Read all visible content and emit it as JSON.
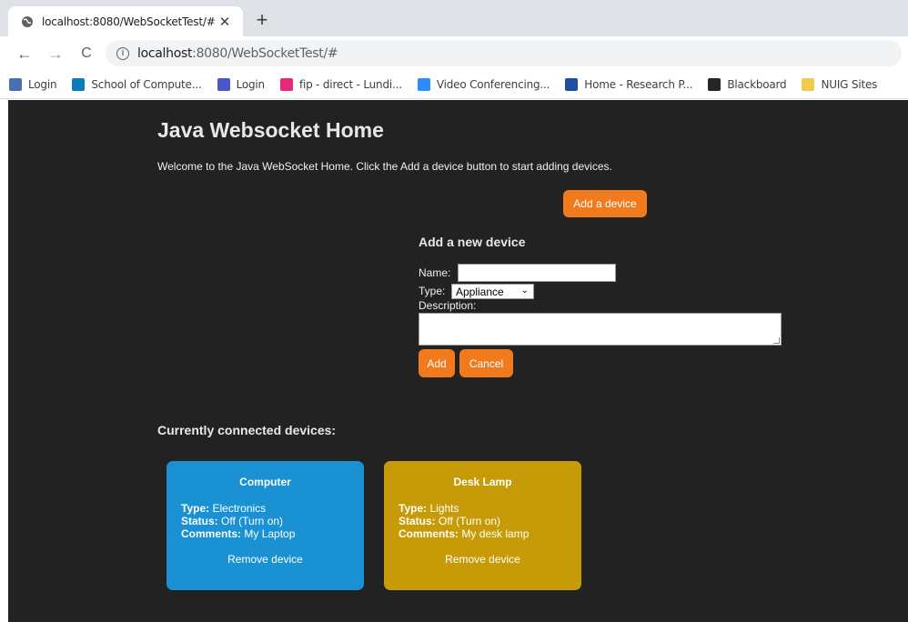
{
  "browser": {
    "tab_title": "localhost:8080/WebSocketTest/#",
    "tab_close": "✕",
    "new_tab": "+",
    "back": "←",
    "forward": "→",
    "reload": "C",
    "url_host": "localhost",
    "url_path": ":8080/WebSocketTest/#",
    "bookmarks": [
      {
        "label": "Login",
        "color": "#4a6fb5"
      },
      {
        "label": "School of Compute...",
        "color": "#0b7bbd"
      },
      {
        "label": "Login",
        "color": "#4b57c6"
      },
      {
        "label": "fip - direct - Lundi...",
        "color": "#e8287c"
      },
      {
        "label": "Video Conferencing...",
        "color": "#2d8cff"
      },
      {
        "label": "Home - Research P...",
        "color": "#1f4fa3"
      },
      {
        "label": "Blackboard",
        "color": "#262626"
      },
      {
        "label": "NUIG Sites",
        "color": "#f2c94c"
      }
    ]
  },
  "page": {
    "title": "Java Websocket Home",
    "intro": "Welcome to the Java WebSocket Home. Click the Add a device button to start adding devices.",
    "add_device_label": "Add a device",
    "form": {
      "title": "Add a new device",
      "name_label": "Name:",
      "name_value": "",
      "type_label": "Type:",
      "type_selected": "Appliance",
      "description_label": "Description:",
      "description_value": "",
      "add_label": "Add",
      "cancel_label": "Cancel"
    },
    "devices_heading": "Currently connected devices:",
    "devices": [
      {
        "name": "Computer",
        "type_label": "Type:",
        "type": "Electronics",
        "status_label": "Status:",
        "status": "Off (Turn on)",
        "comments_label": "Comments:",
        "comments": "My Laptop",
        "remove_label": "Remove device",
        "color": "#1991d2"
      },
      {
        "name": "Desk Lamp",
        "type_label": "Type:",
        "type": "Lights",
        "status_label": "Status:",
        "status": "Off (Turn on)",
        "comments_label": "Comments:",
        "comments": "My desk lamp",
        "remove_label": "Remove device",
        "color": "#c79b08"
      }
    ]
  },
  "colors": {
    "accent": "#f17a1c",
    "page_bg": "#222222"
  }
}
